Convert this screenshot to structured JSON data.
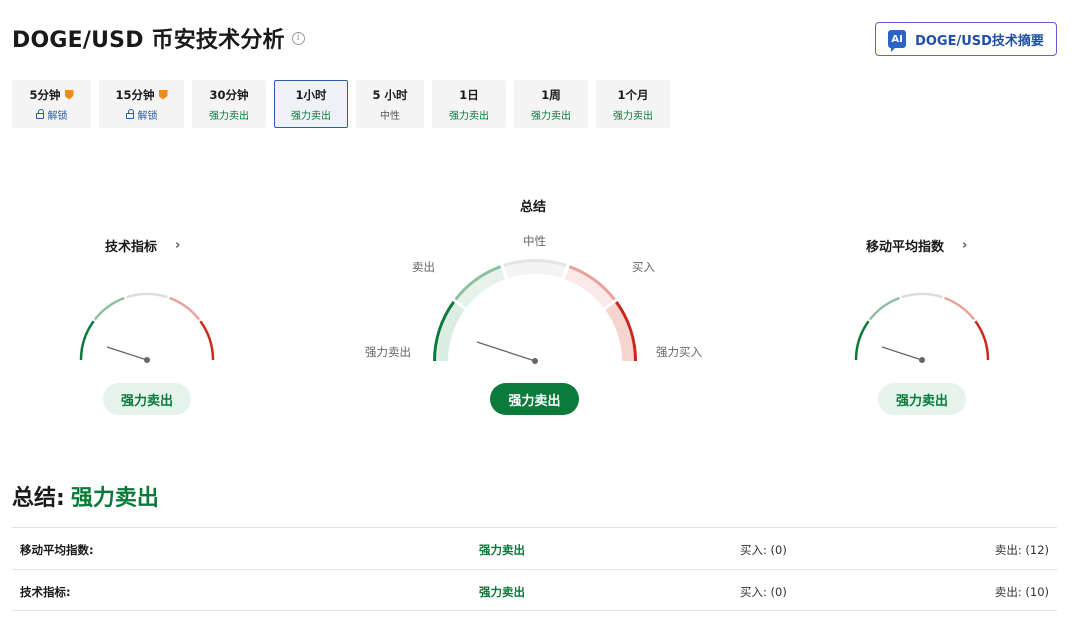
{
  "header": {
    "title": "DOGE/USD 币安技术分析",
    "info_icon": "info-icon",
    "ai_button": {
      "icon_text": "AI",
      "label": "DOGE/USD技术摘要",
      "border_color": "#6b5bd2"
    }
  },
  "tabs": [
    {
      "label": "5分钟",
      "sub": "解锁",
      "locked": true,
      "pro": true
    },
    {
      "label": "15分钟",
      "sub": "解锁",
      "locked": true,
      "pro": true
    },
    {
      "label": "30分钟",
      "sub": "强力卖出",
      "locked": false
    },
    {
      "label": "1小时",
      "sub": "强力卖出",
      "locked": false,
      "active": true
    },
    {
      "label": "5 小时",
      "sub": "中性",
      "locked": false
    },
    {
      "label": "1日",
      "sub": "强力卖出",
      "locked": false
    },
    {
      "label": "1周",
      "sub": "强力卖出",
      "locked": false
    },
    {
      "label": "1个月",
      "sub": "强力卖出",
      "locked": false
    }
  ],
  "gauges": {
    "technical": {
      "title": "技术指标",
      "chevron": "›",
      "signal": "强力卖出"
    },
    "summary": {
      "title": "总结",
      "signal": "强力卖出",
      "labels": {
        "neutral": "中性",
        "sell": "卖出",
        "buy": "买入",
        "strong_sell": "强力卖出",
        "strong_buy": "强力买入"
      }
    },
    "moving_average": {
      "title": "移动平均指数",
      "chevron": "›",
      "signal": "强力卖出"
    }
  },
  "summary": {
    "label": "总结:",
    "value": "强力卖出"
  },
  "table": [
    {
      "name": "移动平均指数:",
      "signal": "强力卖出",
      "buy": "买入: (0)",
      "sell": "卖出: (12)"
    },
    {
      "name": "技术指标:",
      "signal": "强力卖出",
      "buy": "买入: (0)",
      "sell": "卖出: (10)"
    }
  ],
  "colors": {
    "strong_sell": "#0a7a3a",
    "sell": "#8cc0a0",
    "neutral": "#dddddd",
    "buy": "#e8a29a",
    "strong_buy": "#c9281c"
  }
}
